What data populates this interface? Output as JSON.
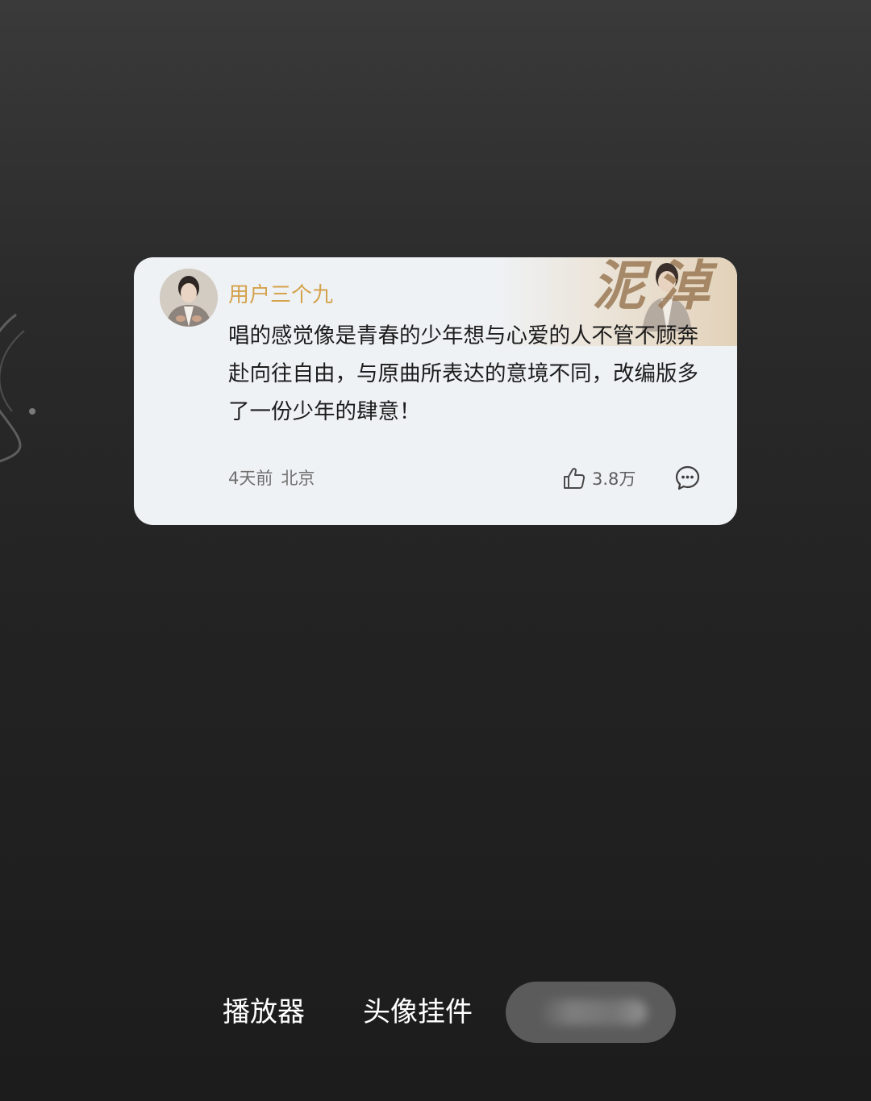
{
  "comment": {
    "username": "用户三个九",
    "text": "唱的感觉像是青春的少年想与心爱的人不管不顾奔赴向往自由，与原曲所表达的意境不同，改编版多了一份少年的肆意！",
    "time": "4天前",
    "location": "北京",
    "likes": "3.8万",
    "decoration_text": "泥淖"
  },
  "bottom_tabs": {
    "player": "播放器",
    "avatar_pendant": "头像挂件",
    "third": ""
  },
  "colors": {
    "username": "#d4a24c",
    "card_background": "#eff2f5",
    "page_background": "#232323"
  },
  "icons": {
    "like": "thumbs-up-icon",
    "reply": "comment-bubble-icon"
  }
}
